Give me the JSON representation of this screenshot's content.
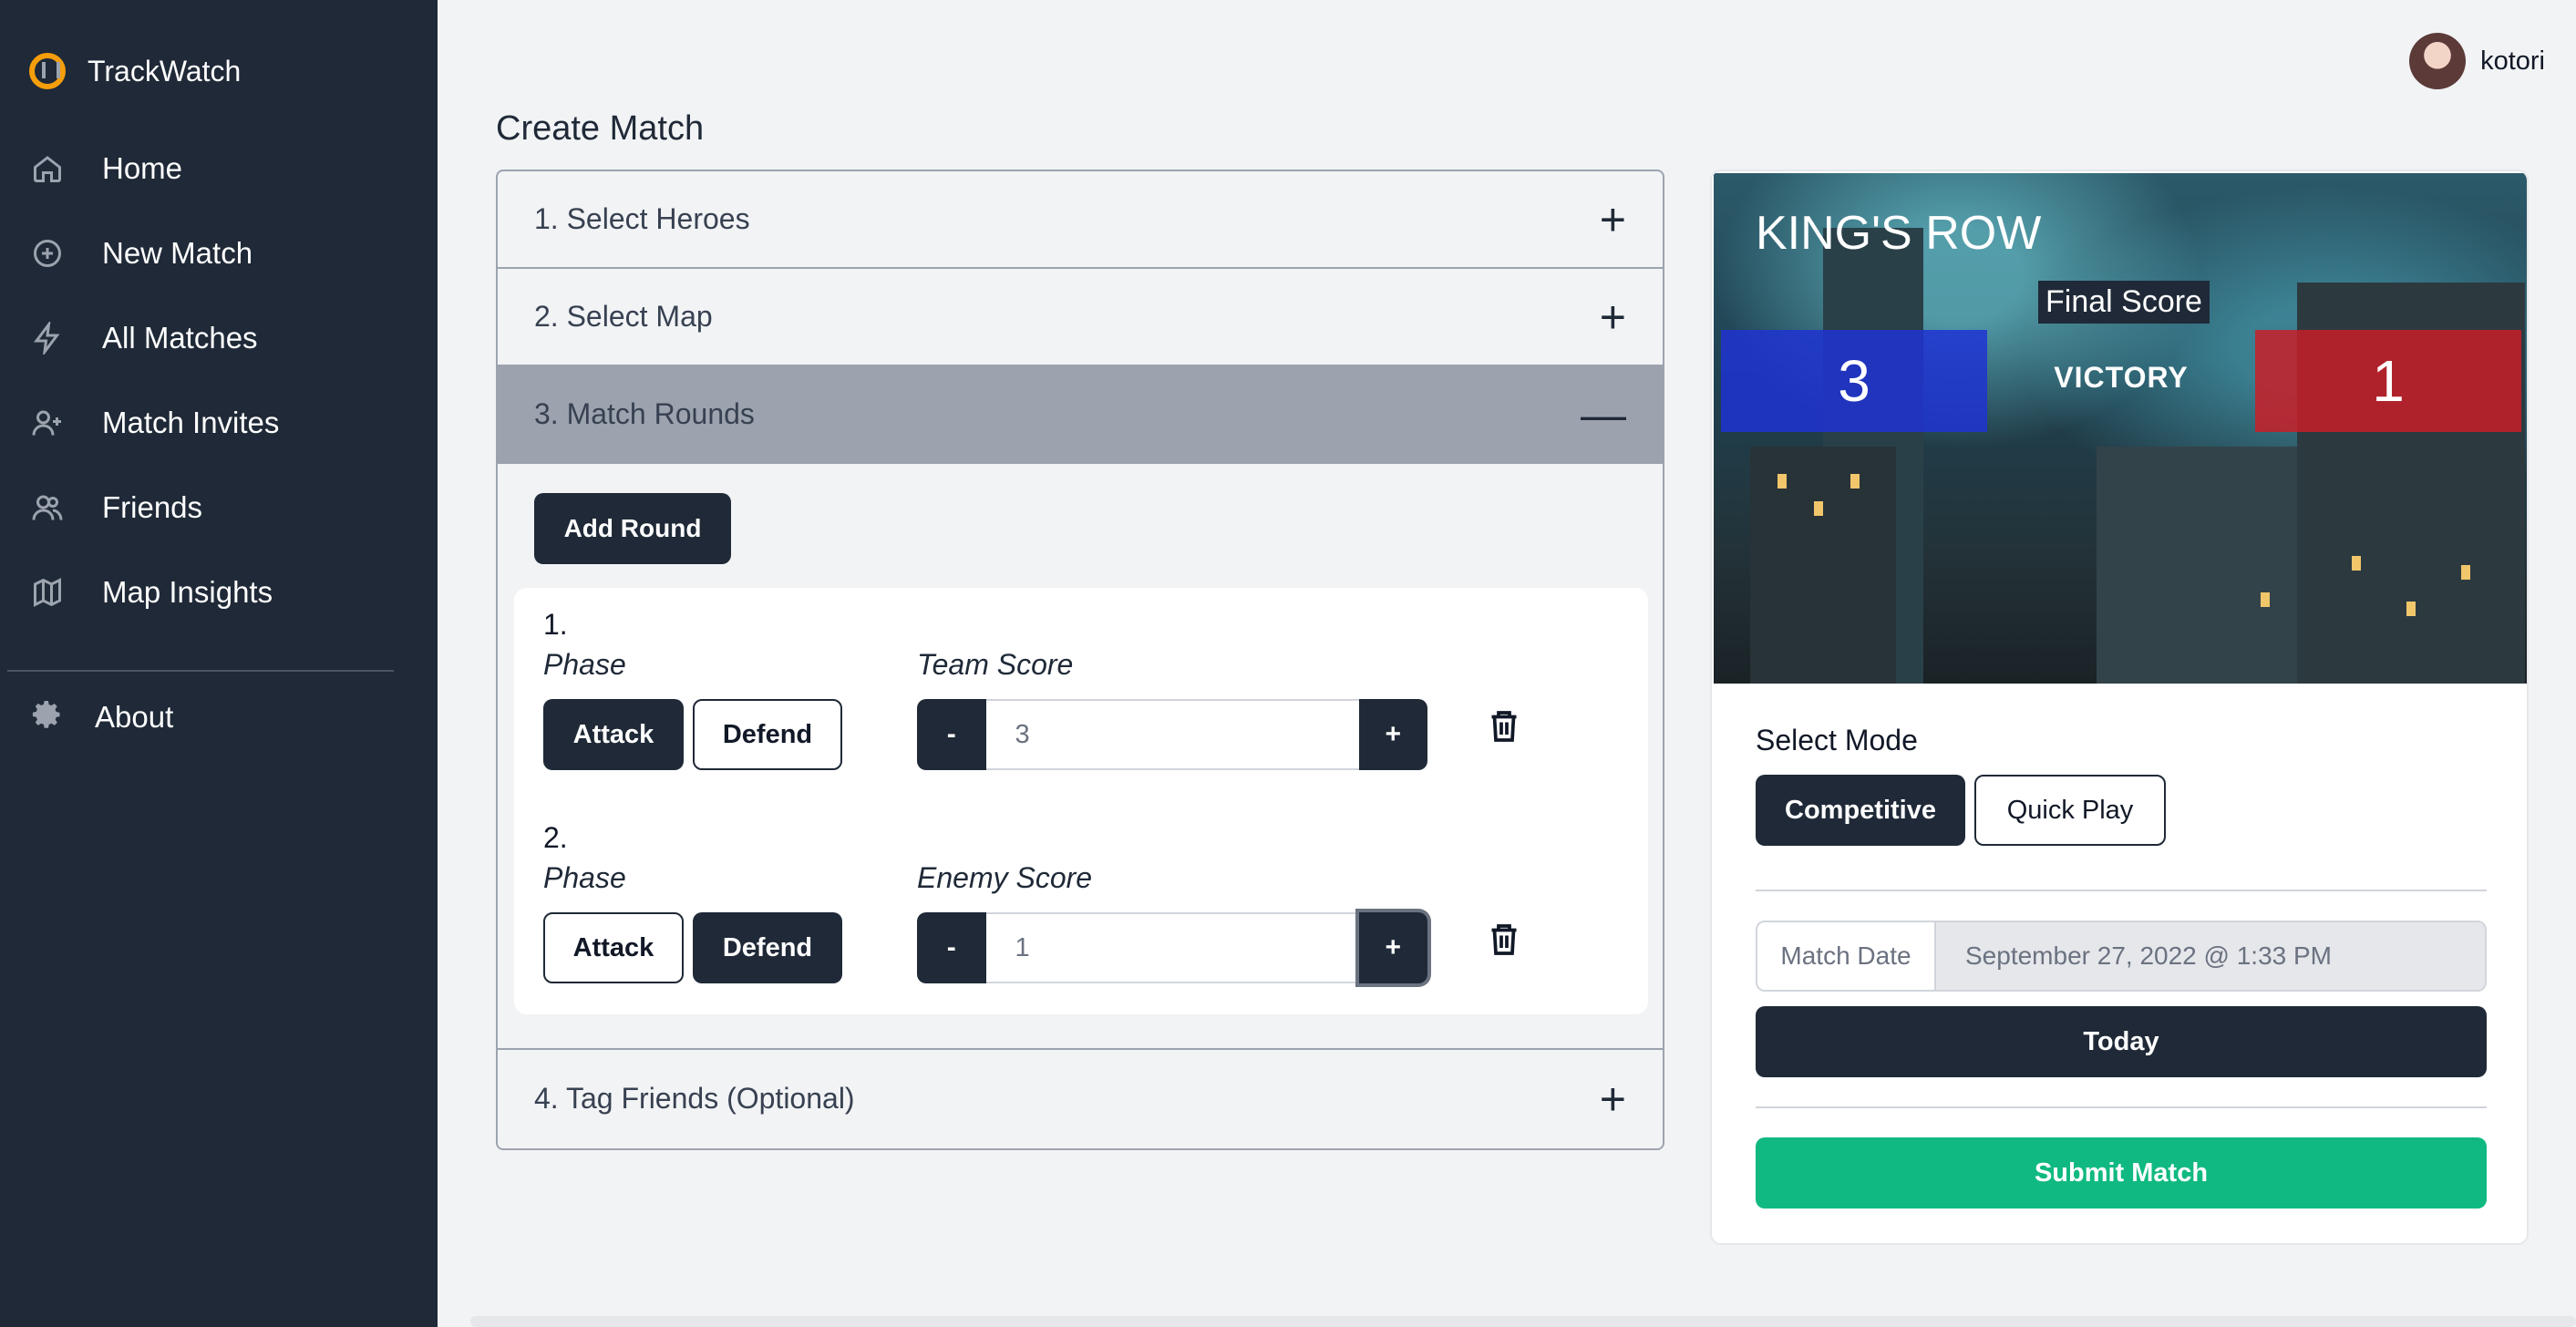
{
  "app": {
    "name": "TrackWatch"
  },
  "nav": {
    "items": [
      {
        "label": "Home",
        "icon": "home-icon"
      },
      {
        "label": "New Match",
        "icon": "plus-circle-icon"
      },
      {
        "label": "All Matches",
        "icon": "bolt-icon"
      },
      {
        "label": "Match Invites",
        "icon": "user-plus-icon"
      },
      {
        "label": "Friends",
        "icon": "users-icon"
      },
      {
        "label": "Map Insights",
        "icon": "map-icon"
      }
    ],
    "about": {
      "label": "About",
      "icon": "gear-icon"
    }
  },
  "user": {
    "name": "kotori"
  },
  "page": {
    "title": "Create Match"
  },
  "accordion": {
    "sections": [
      {
        "title": "1. Select Heroes",
        "toggle": "+"
      },
      {
        "title": "2. Select Map",
        "toggle": "+"
      },
      {
        "title": "3. Match Rounds",
        "toggle": "—"
      },
      {
        "title": "4. Tag Friends (Optional)",
        "toggle": "+"
      }
    ]
  },
  "rounds": {
    "add_label": "Add Round",
    "phase_label": "Phase",
    "attack_label": "Attack",
    "defend_label": "Defend",
    "minus_label": "-",
    "plus_label": "+",
    "items": [
      {
        "number": "1.",
        "phase": "Attack",
        "score_label": "Team Score",
        "score": "3"
      },
      {
        "number": "2.",
        "phase": "Defend",
        "score_label": "Enemy Score",
        "score": "1"
      }
    ]
  },
  "preview": {
    "map_name": "KING'S ROW",
    "final_score_label": "Final Score",
    "team_score": "3",
    "enemy_score": "1",
    "result": "VICTORY",
    "colors": {
      "team": "#1e32d2",
      "enemy": "#c81e28"
    }
  },
  "mode": {
    "label": "Select Mode",
    "options": [
      "Competitive",
      "Quick Play"
    ],
    "selected": "Competitive"
  },
  "date": {
    "label": "Match Date",
    "value": "September 27, 2022 @ 1:33 PM",
    "today_label": "Today"
  },
  "submit_label": "Submit Match",
  "colors": {
    "sidebar": "#1f2937",
    "accent": "#10b981",
    "dark": "#1f2937"
  }
}
